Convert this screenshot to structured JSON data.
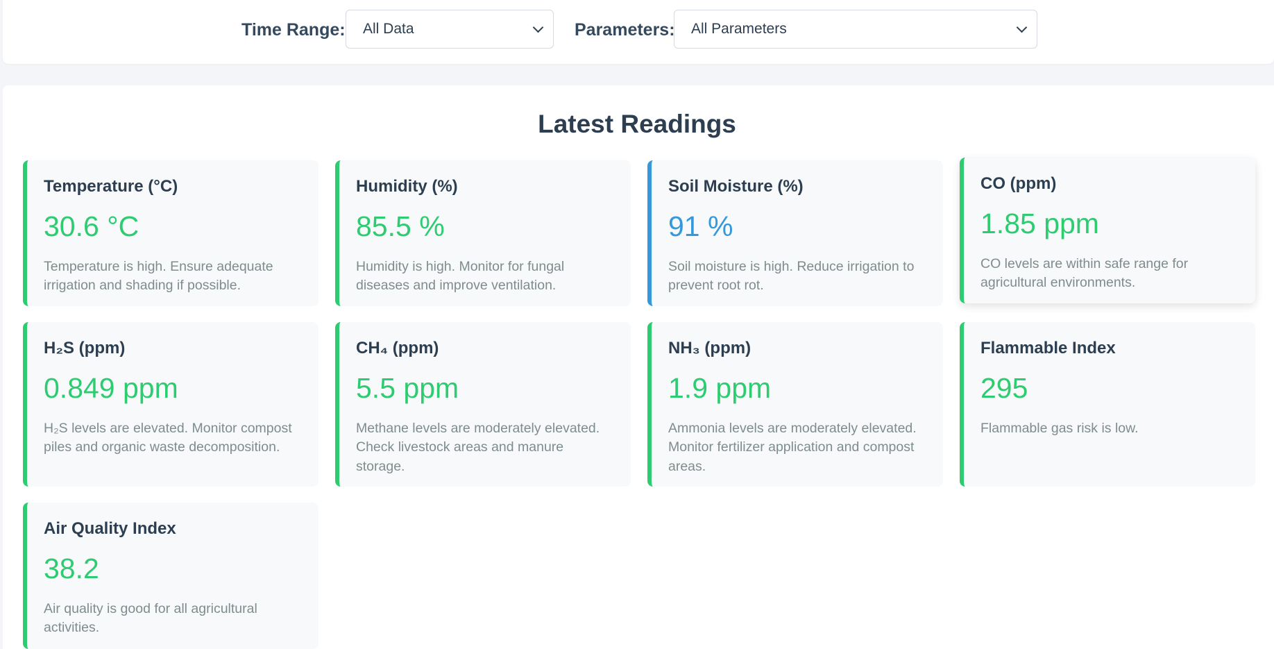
{
  "filters": {
    "time_range": {
      "label": "Time Range:",
      "selected": "All Data"
    },
    "parameters": {
      "label": "Parameters:",
      "selected": "All Parameters"
    }
  },
  "readings": {
    "title": "Latest Readings",
    "cards": [
      {
        "title": "Temperature (°C)",
        "value": "30.6 °C",
        "description": "Temperature is high. Ensure adequate irrigation and shading if possible.",
        "status_color": "#2ecc71"
      },
      {
        "title": "Humidity (%)",
        "value": "85.5 %",
        "description": "Humidity is high. Monitor for fungal diseases and improve ventilation.",
        "status_color": "#2ecc71"
      },
      {
        "title": "Soil Moisture (%)",
        "value": "91 %",
        "description": "Soil moisture is high. Reduce irrigation to prevent root rot.",
        "status_color": "#3498db"
      },
      {
        "title": "CO (ppm)",
        "value": "1.85 ppm",
        "description": "CO levels are within safe range for agricultural environments.",
        "status_color": "#2ecc71"
      },
      {
        "title": "H₂S (ppm)",
        "value": "0.849 ppm",
        "description": "H₂S levels are elevated. Monitor compost piles and organic waste decomposition.",
        "status_color": "#2ecc71"
      },
      {
        "title": "CH₄ (ppm)",
        "value": "5.5 ppm",
        "description": "Methane levels are moderately elevated. Check livestock areas and manure storage.",
        "status_color": "#2ecc71"
      },
      {
        "title": "NH₃ (ppm)",
        "value": "1.9 ppm",
        "description": "Ammonia levels are moderately elevated. Monitor fertilizer application and compost areas.",
        "status_color": "#2ecc71"
      },
      {
        "title": "Flammable Index",
        "value": "295",
        "description": "Flammable gas risk is low.",
        "status_color": "#2ecc71"
      },
      {
        "title": "Air Quality Index",
        "value": "38.2",
        "description": "Air quality is good for all agricultural activities.",
        "status_color": "#2ecc71"
      }
    ]
  }
}
